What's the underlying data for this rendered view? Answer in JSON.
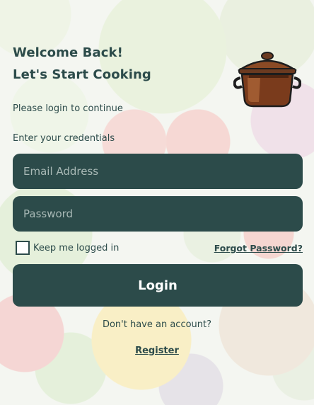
{
  "header": {
    "title_line1": "Welcome Back!",
    "title_line2": "Let's Start Cooking",
    "subtitle": "Please login to continue",
    "credentials_hint": "Enter your credentials"
  },
  "logo": {
    "icon": "cooking-pot-icon"
  },
  "form": {
    "email_placeholder": "Email Address",
    "password_placeholder": "Password",
    "remember_label": "Keep me logged in",
    "remember_checked": false,
    "forgot_label": "Forgot Password?",
    "login_label": "Login"
  },
  "footer": {
    "no_account_text": "Don't have an account?",
    "register_label": "Register"
  },
  "colors": {
    "primary": "#2c4b4a",
    "text_on_primary": "#ffffff",
    "placeholder": "#a9b9b6"
  }
}
